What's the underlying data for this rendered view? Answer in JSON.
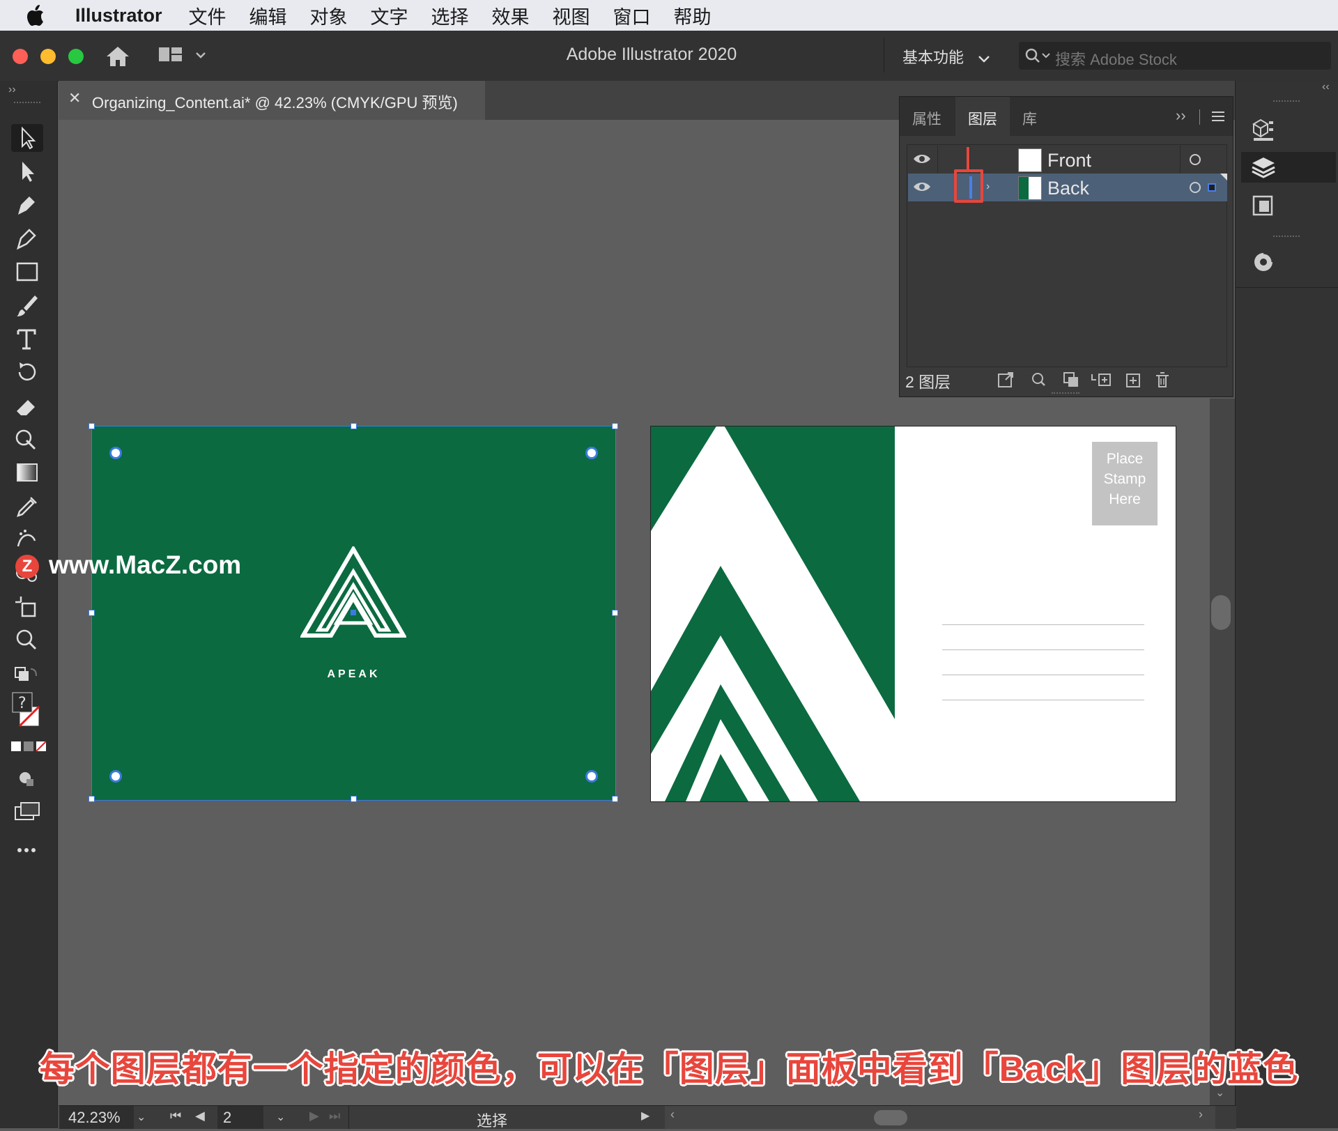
{
  "menubar": {
    "app": "Illustrator",
    "items": [
      "文件",
      "编辑",
      "对象",
      "文字",
      "选择",
      "效果",
      "视图",
      "窗口",
      "帮助"
    ]
  },
  "titlebar": {
    "title": "Adobe Illustrator 2020",
    "workspace": "基本功能",
    "search_placeholder": "搜索 Adobe Stock"
  },
  "document": {
    "tab_title": "Organizing_Content.ai* @ 42.23% (CMYK/GPU 预览)"
  },
  "layers_panel": {
    "tabs": [
      "属性",
      "图层",
      "库"
    ],
    "active_tab": "图层",
    "layers": [
      {
        "name": "Front",
        "selected": false
      },
      {
        "name": "Back",
        "selected": true,
        "color": "#4a7fe6"
      }
    ],
    "count_label": "2 图层"
  },
  "artboards": {
    "front_logo_text": "APEAK",
    "stamp_lines": [
      "Place",
      "Stamp",
      "Here"
    ],
    "green": "#0b6a40"
  },
  "statusbar": {
    "zoom": "42.23%",
    "artboard_number": "2",
    "tool": "选择"
  },
  "watermark": "www.MacZ.com",
  "caption": "每个图层都有一个指定的颜色，可以在「图层」面板中看到「Back」图层的蓝色"
}
